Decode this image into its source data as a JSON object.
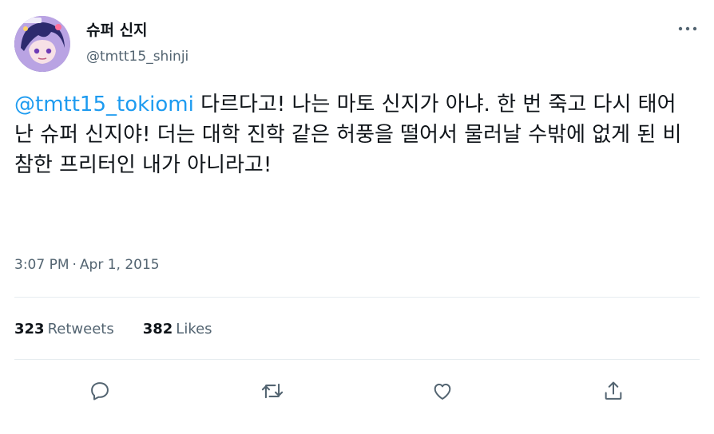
{
  "user": {
    "display_name": "슈퍼 신지",
    "handle": "@tmtt15_shinji"
  },
  "tweet": {
    "mention": "@tmtt15_tokiomi",
    "text": " 다르다고! 나는 마토 신지가 아냐. 한 번 죽고 다시 태어난 슈퍼 신지야! 더는 대학 진학 같은 허풍을 떨어서 물러날 수밖에 없게 된 비참한 프리터인 내가 아니라고!",
    "time": "3:07 PM",
    "separator": "·",
    "date": "Apr 1, 2015"
  },
  "stats": {
    "retweets_count": "323",
    "retweets_label": "Retweets",
    "likes_count": "382",
    "likes_label": "Likes"
  },
  "icons": {
    "more": "more-horizontal-icon",
    "reply": "reply-icon",
    "retweet": "retweet-icon",
    "like": "like-icon",
    "share": "share-icon"
  },
  "colors": {
    "accent": "#1d9bf0",
    "text": "#0f1419",
    "secondary": "#536471",
    "divider": "#e6ecf0"
  }
}
